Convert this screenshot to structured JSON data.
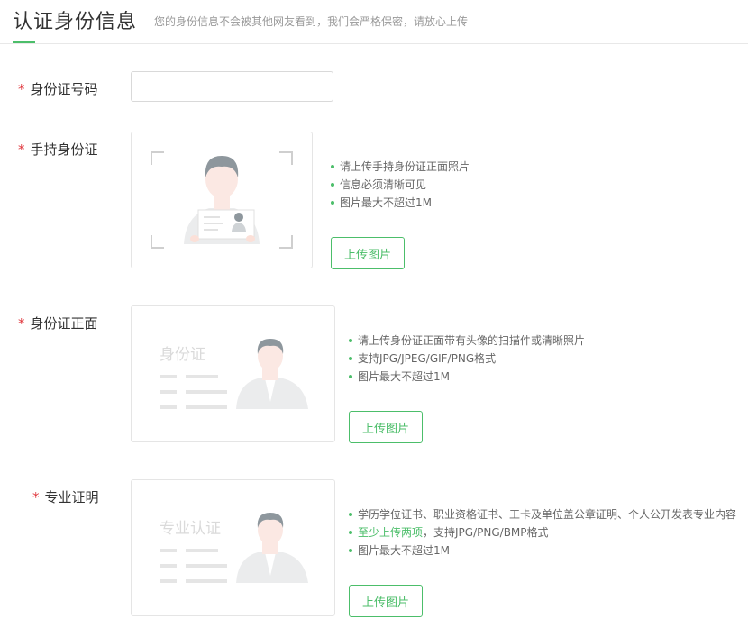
{
  "header": {
    "title": "认证身份信息",
    "subtitle": "您的身份信息不会被其他网友看到，我们会严格保密，请放心上传"
  },
  "required_mark": "*",
  "id_number": {
    "label": "身份证号码",
    "value": "",
    "placeholder": ""
  },
  "handheld": {
    "label": "手持身份证",
    "tips": [
      "请上传手持身份证正面照片",
      "信息必须清晰可见",
      "图片最大不超过1M"
    ],
    "button": "上传图片"
  },
  "id_front": {
    "label": "身份证正面",
    "card_text": "身份证",
    "tips": [
      "请上传身份证正面带有头像的扫描件或清晰照片",
      "支持JPG/JPEG/GIF/PNG格式",
      "图片最大不超过1M"
    ],
    "button": "上传图片"
  },
  "professional": {
    "label": "专业证明",
    "card_text": "专业认证",
    "tips": [
      "学历学位证书、职业资格证书、工卡及单位盖公章证明、个人公开发表专业内容"
    ],
    "tip2_highlight": "至少上传两项",
    "tip2_rest": "，支持JPG/PNG/BMP格式",
    "tip3": "图片最大不超过1M",
    "button": "上传图片"
  },
  "colors": {
    "accent": "#4cbe6a",
    "required": "#e0383e"
  }
}
